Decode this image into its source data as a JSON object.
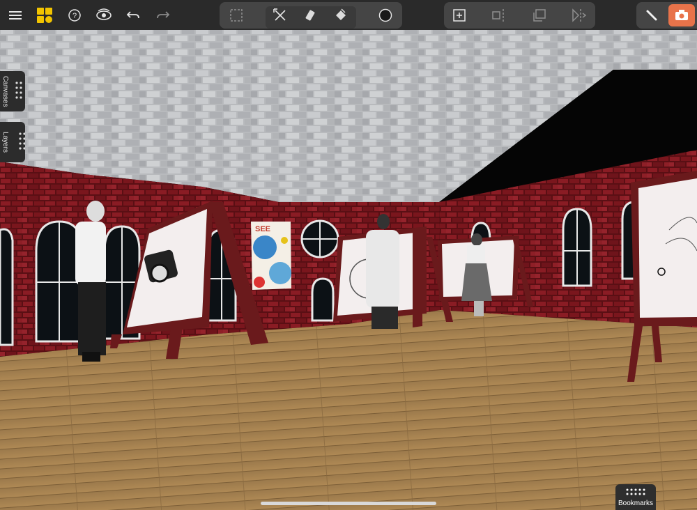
{
  "app": {
    "brand_color": "#f2c400",
    "accent_color": "#e8734a"
  },
  "toolbar": {
    "left": [
      {
        "icon": "menu-icon"
      },
      {
        "icon": "app-logo-icon"
      },
      {
        "icon": "help-icon"
      },
      {
        "icon": "view-eye-icon"
      },
      {
        "icon": "undo-icon"
      },
      {
        "icon": "redo-icon"
      }
    ],
    "center_tools": [
      {
        "icon": "selection-marquee-icon"
      },
      {
        "icon": "transform-tool-icon",
        "active": true
      },
      {
        "icon": "eraser-icon",
        "active": true
      },
      {
        "icon": "paint-bucket-icon",
        "active": true
      },
      {
        "icon": "color-picker-icon"
      }
    ],
    "right_tools": [
      {
        "icon": "add-canvas-icon"
      },
      {
        "icon": "align-icon"
      },
      {
        "icon": "duplicate-icon"
      },
      {
        "icon": "mirror-icon"
      }
    ],
    "mode": [
      {
        "icon": "brush-icon"
      },
      {
        "icon": "camera-icon",
        "active": true
      }
    ]
  },
  "side_tabs": {
    "canvases": "Canvases",
    "layers": "Layers"
  },
  "bookmarks": {
    "label": "Bookmarks"
  },
  "scene": {
    "poster_text": "SEE"
  }
}
